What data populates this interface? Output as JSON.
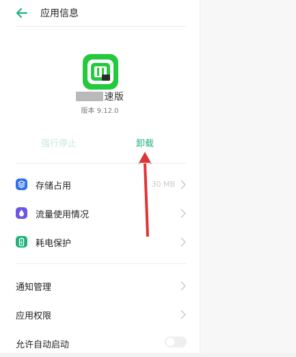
{
  "header": {
    "title": "应用信息"
  },
  "app": {
    "name": "速版",
    "version": "版本 9.12.0"
  },
  "actions": {
    "force_stop": "强行停止",
    "uninstall": "卸载"
  },
  "settings_group1": [
    {
      "label": "存储占用",
      "value": "30 MB",
      "icon": "storage-icon",
      "color": "#2f6fe8"
    },
    {
      "label": "流量使用情况",
      "value": "",
      "icon": "data-usage-icon",
      "color": "#6b55e6"
    },
    {
      "label": "耗电保护",
      "value": "",
      "icon": "battery-icon",
      "color": "#21b27a"
    }
  ],
  "settings_group2": [
    {
      "label": "通知管理"
    },
    {
      "label": "应用权限"
    },
    {
      "label": "允许自动启动"
    }
  ],
  "colors": {
    "accent": "#21b27a",
    "annotation": "#e03333"
  }
}
